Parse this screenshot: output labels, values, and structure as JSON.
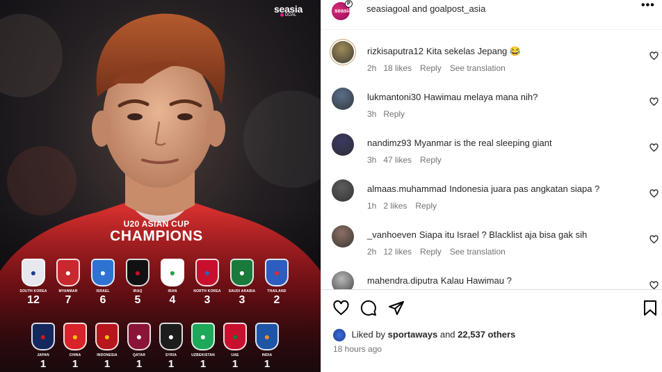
{
  "media": {
    "brand": {
      "name": "seasia",
      "sub": "GOAL"
    },
    "title_small": "U20 ASIAN CUP",
    "title_big": "CHAMPIONS",
    "row1": [
      {
        "name": "SOUTH KOREA",
        "count": "12",
        "color": "#e7e7ee",
        "accent": "#1f3c8a",
        "icon": "tiger-crest-icon"
      },
      {
        "name": "MYANMAR",
        "count": "7",
        "color": "#c8282e",
        "accent": "#ffffff",
        "icon": "myanmar-crest-icon"
      },
      {
        "name": "ISRAEL",
        "count": "6",
        "color": "#2e73d1",
        "accent": "#ffffff",
        "icon": "israel-crest-icon"
      },
      {
        "name": "IRAQ",
        "count": "5",
        "color": "#111111",
        "accent": "#c8102e",
        "icon": "iraq-crest-icon"
      },
      {
        "name": "IRAN",
        "count": "4",
        "color": "#ffffff",
        "accent": "#239f40",
        "icon": "iran-crest-icon"
      },
      {
        "name": "NORTH KOREA",
        "count": "3",
        "color": "#c8102e",
        "accent": "#2d60c5",
        "icon": "north-korea-crest-icon"
      },
      {
        "name": "SAUDI ARABIA",
        "count": "3",
        "color": "#1a7a3c",
        "accent": "#ffffff",
        "icon": "saudi-crest-icon"
      },
      {
        "name": "THAILAND",
        "count": "2",
        "color": "#2c5dbf",
        "accent": "#e12a2a",
        "icon": "thailand-crest-icon"
      }
    ],
    "row2": [
      {
        "name": "JAPAN",
        "count": "1",
        "color": "#14285e",
        "accent": "#d7141a",
        "icon": "japan-crest-icon"
      },
      {
        "name": "CHINA",
        "count": "1",
        "color": "#d8232a",
        "accent": "#f7c300",
        "icon": "china-crest-icon"
      },
      {
        "name": "INDONESIA",
        "count": "1",
        "color": "#b6161c",
        "accent": "#f2c200",
        "icon": "indonesia-crest-icon"
      },
      {
        "name": "QATAR",
        "count": "1",
        "color": "#8a1538",
        "accent": "#ffffff",
        "icon": "qatar-crest-icon"
      },
      {
        "name": "SYRIA",
        "count": "1",
        "color": "#1d1d1d",
        "accent": "#ffffff",
        "icon": "syria-crest-icon"
      },
      {
        "name": "UZBEKISTAN",
        "count": "1",
        "color": "#1ea85a",
        "accent": "#ffffff",
        "icon": "uzbekistan-crest-icon"
      },
      {
        "name": "UAE",
        "count": "1",
        "color": "#c8102e",
        "accent": "#00843d",
        "icon": "uae-crest-icon"
      },
      {
        "name": "INDIA",
        "count": "1",
        "color": "#1f55a5",
        "accent": "#f28c28",
        "icon": "india-crest-icon"
      }
    ]
  },
  "header": {
    "title": "seasiagoal and goalpost_asia",
    "avatar_text": "seasia",
    "more_icon": "more-horizontal-icon"
  },
  "comments": [
    {
      "user": "rizkisaputra12",
      "text": "Kita sekelas Jepang 😂",
      "time": "2h",
      "likes": "18 likes",
      "reply": "Reply",
      "translate": "See translation",
      "avatar_color": "#a08c5a"
    },
    {
      "user": "lukmantoni30",
      "text": "Hawimau melaya mana nih?",
      "time": "3h",
      "likes": "",
      "reply": "Reply",
      "translate": "",
      "avatar_color": "#5a6f8c"
    },
    {
      "user": "nandimz93",
      "text": "Myanmar is the real sleeping giant",
      "time": "3h",
      "likes": "47 likes",
      "reply": "Reply",
      "translate": "",
      "avatar_color": "#3a3a62"
    },
    {
      "user": "almaas.muhammad",
      "text": "Indonesia juara pas angkatan siapa ?",
      "time": "1h",
      "likes": "2 likes",
      "reply": "Reply",
      "translate": "",
      "avatar_color": "#5d5d5d"
    },
    {
      "user": "_vanhoeven",
      "text": "Siapa itu Israel ? Blacklist aja bisa gak sih",
      "time": "2h",
      "likes": "12 likes",
      "reply": "Reply",
      "translate": "See translation",
      "avatar_color": "#8b6f64"
    },
    {
      "user": "mahendra.diputra",
      "text": "Kalau Hawimau ?",
      "time": "",
      "likes": "",
      "reply": "",
      "translate": "",
      "avatar_color": "#b8b8b8"
    }
  ],
  "footer": {
    "liked_prefix": "Liked by",
    "liked_user": "sportaways",
    "liked_and": "and",
    "liked_others": "22,537 others",
    "time_ago": "18 hours ago"
  },
  "colors": {
    "text": "#262626",
    "muted": "#737373",
    "divider": "#dbdbdb",
    "jersey": "#c8202a"
  }
}
